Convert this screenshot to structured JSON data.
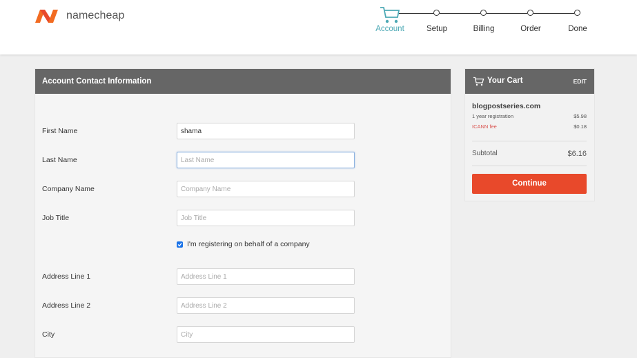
{
  "brand": {
    "name": "namecheap"
  },
  "steps": [
    {
      "label": "Account",
      "active": true
    },
    {
      "label": "Setup",
      "active": false
    },
    {
      "label": "Billing",
      "active": false
    },
    {
      "label": "Order",
      "active": false
    },
    {
      "label": "Done",
      "active": false
    }
  ],
  "colors": {
    "accent": "#4da9b5",
    "brand_orange": "#e8492b",
    "panel_header": "#666666"
  },
  "form": {
    "title": "Account Contact Information",
    "fields": {
      "first_name": {
        "label": "First Name",
        "value": "shama",
        "placeholder": ""
      },
      "last_name": {
        "label": "Last Name",
        "value": "",
        "placeholder": "Last Name"
      },
      "company_name": {
        "label": "Company Name",
        "value": "",
        "placeholder": "Company Name"
      },
      "job_title": {
        "label": "Job Title",
        "value": "",
        "placeholder": "Job Title"
      },
      "address1": {
        "label": "Address Line 1",
        "value": "",
        "placeholder": "Address Line 1"
      },
      "address2": {
        "label": "Address Line 2",
        "value": "",
        "placeholder": "Address Line 2"
      },
      "city": {
        "label": "City",
        "value": "",
        "placeholder": "City"
      }
    },
    "company_checkbox": {
      "label": "I'm registering on behalf of a company",
      "checked": true
    }
  },
  "cart": {
    "title": "Your Cart",
    "edit_label": "EDIT",
    "domain": "blogpostseries.com",
    "lines": [
      {
        "label": "1 year registration",
        "price": "$5.98"
      },
      {
        "label": "ICANN fee",
        "price": "$0.18"
      }
    ],
    "subtotal_label": "Subtotal",
    "subtotal_value": "$6.16",
    "continue_label": "Continue"
  }
}
